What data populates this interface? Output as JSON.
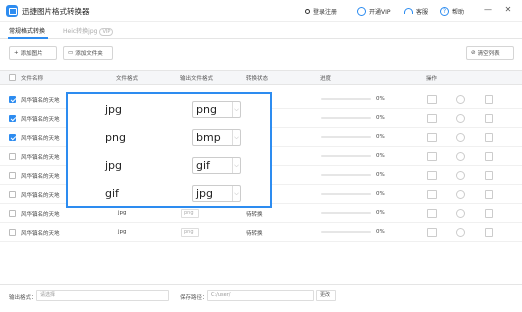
{
  "titlebar": {
    "title": "迅捷图片格式转换器",
    "login": "登录注册",
    "vip": "开通VIP",
    "service": "客服",
    "help": "帮助",
    "minimize": "—",
    "close": "✕"
  },
  "tabs": [
    {
      "label": "常规格式转换"
    },
    {
      "label": "Heic转换jpg",
      "badge": "VIP"
    }
  ],
  "toolbar": {
    "add_image": "添加图片",
    "add_folder": "添加文件夹",
    "clear_list": "清空列表"
  },
  "table": {
    "headers": [
      "文件名称",
      "文件格式",
      "输出文件格式",
      "转换状态",
      "进度",
      "操作"
    ],
    "rows": [
      {
        "name": "风华镇名的天地",
        "checked": true,
        "format": "jpg",
        "output": "png",
        "status": "",
        "progress": "0%"
      },
      {
        "name": "风华镇名的天地",
        "checked": true,
        "format": "jpg",
        "output": "png",
        "status": "",
        "progress": "0%"
      },
      {
        "name": "风华镇名的天地",
        "checked": true,
        "format": "jpg",
        "output": "png",
        "status": "",
        "progress": "0%"
      },
      {
        "name": "风华镇名的天地",
        "checked": false,
        "format": "jpg",
        "output": "png",
        "status": "",
        "progress": "0%"
      },
      {
        "name": "风华镇名的天地",
        "checked": false,
        "format": "jpg",
        "output": "png",
        "status": "",
        "progress": "0%"
      },
      {
        "name": "风华镇名的天地",
        "checked": false,
        "format": "jpg",
        "output": "png",
        "status": "",
        "progress": "0%"
      },
      {
        "name": "风华镇名的天地",
        "checked": false,
        "format": "jpg",
        "output": "png",
        "status": "待转换",
        "progress": "0%"
      },
      {
        "name": "风华镇名的天地",
        "checked": false,
        "format": "jpg",
        "output": "png",
        "status": "待转换",
        "progress": "0%"
      }
    ]
  },
  "overlay": {
    "items": [
      {
        "from": "jpg",
        "to": "png"
      },
      {
        "from": "png",
        "to": "bmp"
      },
      {
        "from": "jpg",
        "to": "gif"
      },
      {
        "from": "gif",
        "to": "jpg"
      }
    ]
  },
  "bottom": {
    "output_format_label": "输出格式：",
    "output_format_placeholder": "请选择",
    "save_path_label": "保存路径：",
    "save_path_value": "C:/user/",
    "change_button": "更改"
  },
  "colors": {
    "accent": "#2d8cf0"
  }
}
